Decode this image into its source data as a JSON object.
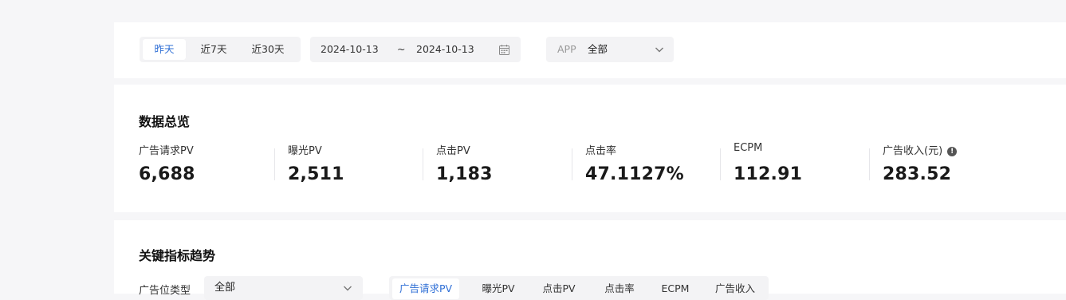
{
  "filter": {
    "range_buttons": [
      "昨天",
      "近7天",
      "近30天"
    ],
    "date_start": "2024-10-13",
    "date_sep": "~",
    "date_end": "2024-10-13",
    "app_label": "APP",
    "app_value": "全部"
  },
  "overview": {
    "title": "数据总览",
    "metrics": [
      {
        "label": "广告请求PV",
        "value": "6,688"
      },
      {
        "label": "曝光PV",
        "value": "2,511"
      },
      {
        "label": "点击PV",
        "value": "1,183"
      },
      {
        "label": "点击率",
        "value": "47.1127%"
      },
      {
        "label": "ECPM",
        "value": "112.91"
      },
      {
        "label": "广告收入(元)",
        "value": "283.52"
      }
    ]
  },
  "trend": {
    "title": "关键指标趋势",
    "ad_type_label": "广告位类型",
    "ad_type_value": "全部",
    "tabs": [
      "广告请求PV",
      "曝光PV",
      "点击PV",
      "点击率",
      "ECPM",
      "广告收入"
    ]
  },
  "colors": {
    "accent": "#2f6fd6",
    "page_bg": "#f6f6f8",
    "control_bg": "#f3f3f5"
  },
  "icons": {
    "calendar": "calendar-icon",
    "dropdown": "chevron-down-icon",
    "info": "info-icon"
  }
}
